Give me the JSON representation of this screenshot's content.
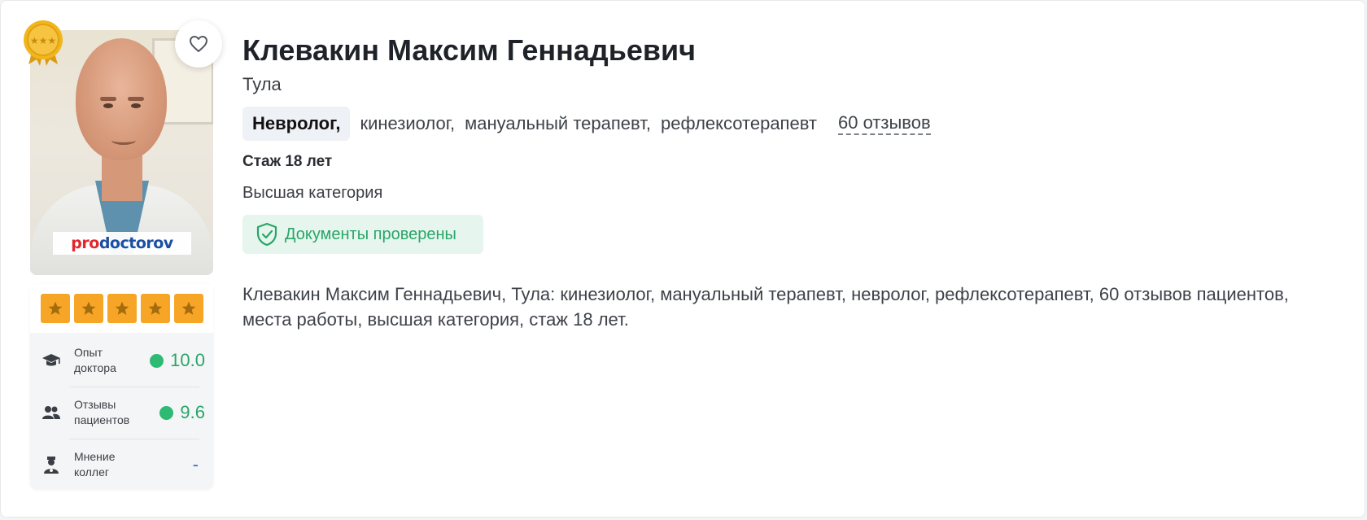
{
  "doctor": {
    "name": "Клевакин Максим Геннадьевич",
    "city": "Тула",
    "main_specialty": "Невролог,",
    "other_specialties": [
      "кинезиолог,",
      "мануальный терапевт,",
      "рефлексотерапевт"
    ],
    "reviews_link": "60 отзывов",
    "experience": "Стаж 18 лет",
    "category": "Высшая категория",
    "verified_label": "Документы проверены",
    "description": "Клевакин Максим Геннадьевич, Тула: кинезиолог, мануальный терапевт, невролог, рефлексотерапевт, 60 отзывов пациентов, места работы, высшая категория, стаж 18 лет."
  },
  "photo": {
    "watermark": "prodoctorov",
    "award_icon": "gold-medal-icon",
    "favorite_icon": "heart-icon"
  },
  "rating": {
    "stars": 5,
    "metrics": [
      {
        "label": "Опыт доктора",
        "score": "10.0",
        "icon": "graduation-cap-icon"
      },
      {
        "label": "Отзывы пациентов",
        "score": "9.6",
        "icon": "users-icon"
      },
      {
        "label": "Мнение коллег",
        "score": "-",
        "icon": "doctor-icon"
      }
    ]
  },
  "colors": {
    "star": "#f7a526",
    "score_green": "#2aa568",
    "verified_bg": "#e6f6ee",
    "dash_blue": "#2f6fd0"
  }
}
